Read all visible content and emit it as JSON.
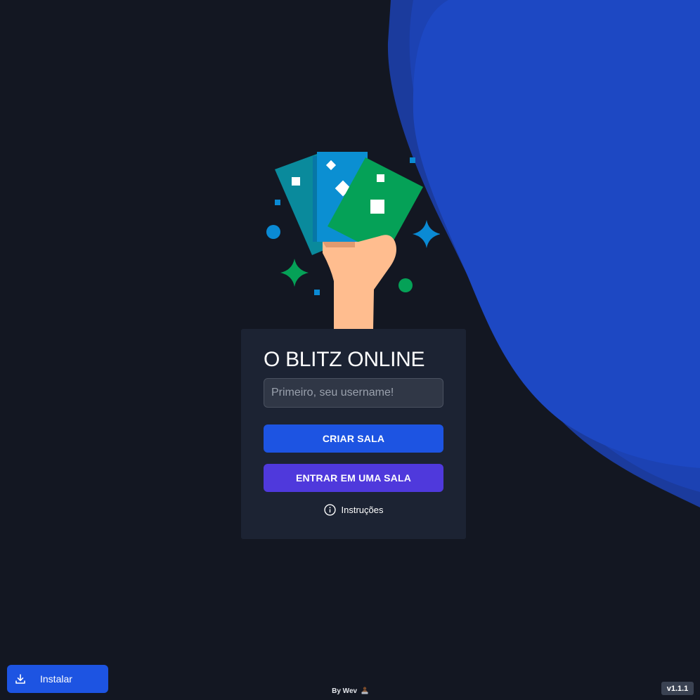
{
  "background_color": "#131722",
  "accent_blob_colors": [
    "#1a3a9a",
    "#1c45b8",
    "#1d48c3"
  ],
  "illustration": {
    "icon": "hand-holding-cards-icon",
    "colors": {
      "card_teal": "#0a8a9c",
      "card_blue": "#0b8fd2",
      "card_green": "#05a157",
      "hand": "#ffbd8f"
    }
  },
  "login_card": {
    "title": "O BLITZ ONLINE",
    "username_input": {
      "value": "",
      "placeholder": "Primeiro, seu username!"
    },
    "create_room_label": "CRIAR SALA",
    "join_room_label": "ENTRAR EM UMA SALA",
    "instructions_label": "Instruções",
    "instructions_icon": "info-icon"
  },
  "install_button": {
    "label": "Instalar",
    "icon": "download-icon"
  },
  "footer": {
    "credit": "By Wev",
    "credit_icon": "person-at-laptop-icon"
  },
  "version": "v1.1.1",
  "colors": {
    "primary": "#1d54e2",
    "secondary": "#4f39dc",
    "card_bg": "#1c2333"
  }
}
